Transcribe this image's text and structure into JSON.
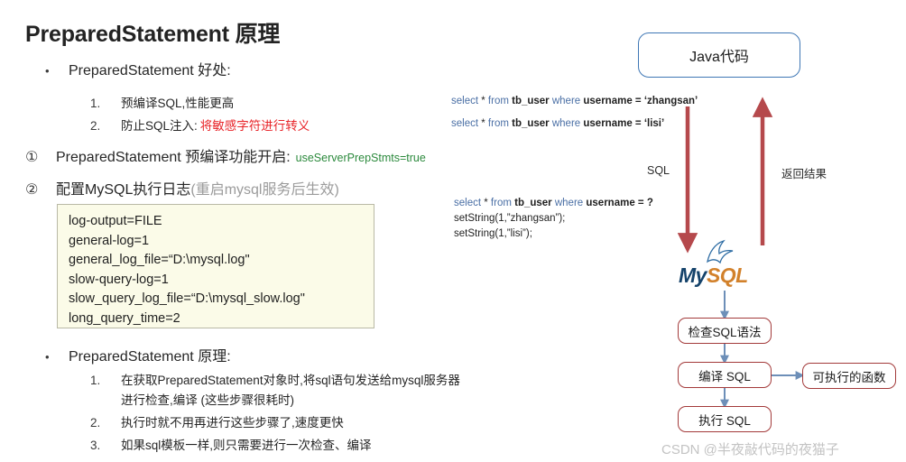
{
  "title": "PreparedStatement 原理",
  "left": {
    "bullet1": {
      "marker": "•",
      "text": "PreparedStatement 好处:",
      "items": [
        {
          "num": "1.",
          "text": "预编译SQL,性能更高"
        },
        {
          "num": "2.",
          "text_prefix": "防止SQL注入:",
          "text_red": "将敏感字符进行转义"
        }
      ]
    },
    "numbered": [
      {
        "marker": "①",
        "text": "PreparedStatement 预编译功能开启:",
        "code": "useServerPrepStmts=true"
      },
      {
        "marker": "②",
        "text": "配置MySQL执行日志",
        "note": "(重启mysql服务后生效)"
      }
    ],
    "codebox": [
      "log-output=FILE",
      "general-log=1",
      "general_log_file=“D:\\mysql.log\"",
      "slow-query-log=1",
      "slow_query_log_file=“D:\\mysql_slow.log\"",
      "long_query_time=2"
    ],
    "bullet2": {
      "marker": "•",
      "text": "PreparedStatement 原理:",
      "items": [
        {
          "num": "1.",
          "line1": "在获取PreparedStatement对象时,将sql语句发送给mysql服务器",
          "line2": "进行检查,编译 (这些步骤很耗时)"
        },
        {
          "num": "2.",
          "line1": "执行时就不用再进行这些步骤了,速度更快"
        },
        {
          "num": "3.",
          "line1": "如果sql模板一样,则只需要进行一次检查、编译"
        }
      ]
    }
  },
  "diagram": {
    "java_box_label": "Java代码",
    "sql_top": [
      {
        "kw1": "select",
        "star": " * ",
        "kw2": "from",
        "table": " tb_user ",
        "kw3": "where",
        "rest": " username = ‘zhangsan’"
      },
      {
        "kw1": "select",
        "star": " * ",
        "kw2": "from",
        "table": " tb_user ",
        "kw3": "where",
        "rest": " username = ‘lisi’"
      }
    ],
    "sql_bottom": {
      "line1": {
        "kw1": "select",
        "star": " * ",
        "kw2": "from",
        "table": " tb_user ",
        "kw3": "where",
        "rest": " username = ?"
      },
      "line2": "setString(1,”zhangsan”);",
      "line3": "setString(1,”lisi”);"
    },
    "label_sql": "SQL",
    "label_return": "返回结果",
    "mysql_logo": {
      "part1": "My",
      "part2": "SQL"
    },
    "flow": [
      {
        "id": "check",
        "label": "检查SQL语法"
      },
      {
        "id": "compile",
        "label": "编译 SQL"
      },
      {
        "id": "exec",
        "label": "执行 SQL"
      },
      {
        "id": "func",
        "label": "可执行的函数"
      }
    ]
  },
  "watermark": "CSDN @半夜敲代码的夜猫子",
  "colors": {
    "red_arrow": "#b5494c",
    "blue_arrow": "#6d8fb8",
    "box_border_red": "#a33a3a",
    "box_border_blue": "#3f77b5",
    "code_bg": "#fbfbe8",
    "green": "#2c8a3d",
    "red_text": "#e8252a",
    "mysql_navy": "#15436b",
    "mysql_orange": "#d2812b"
  }
}
